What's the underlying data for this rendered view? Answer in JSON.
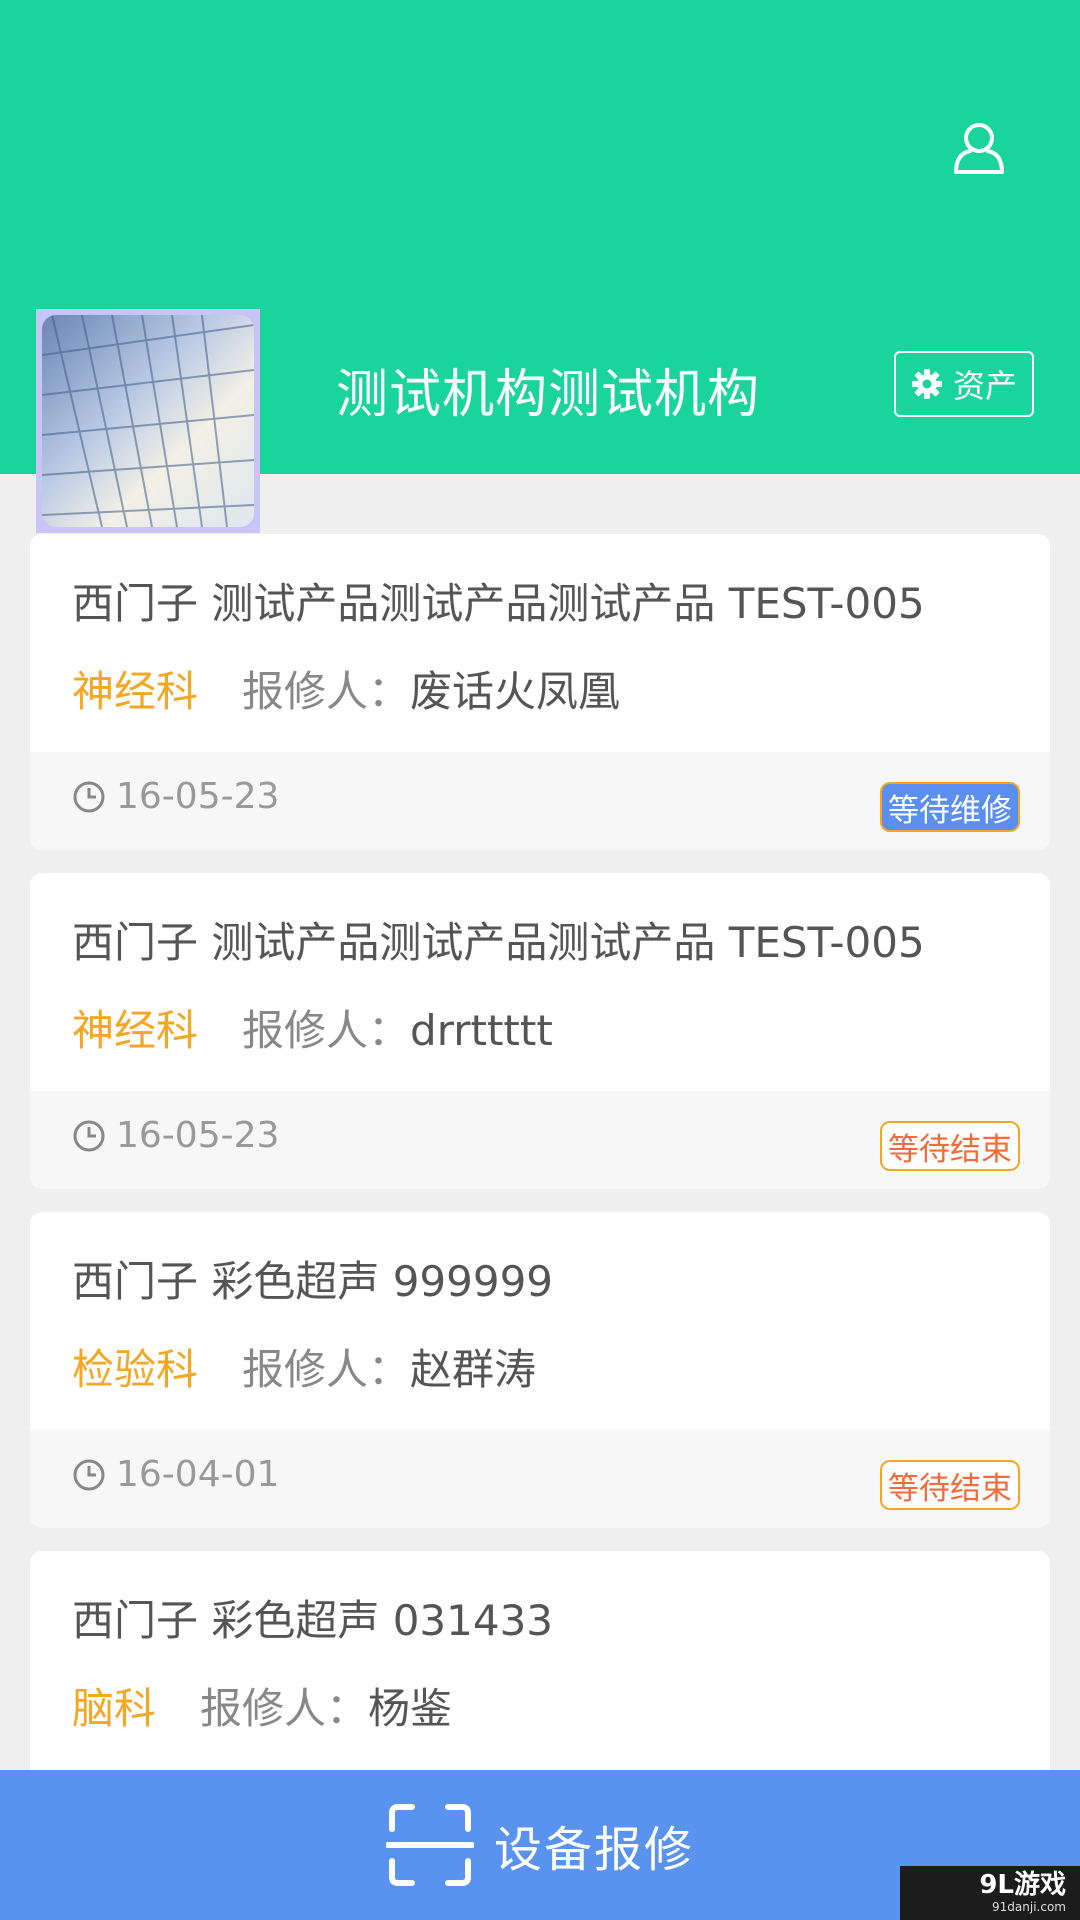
{
  "header": {
    "org_name": "测试机构测试机构",
    "assets_label": "资产",
    "profile_icon": "user-icon",
    "assets_icon": "gear-icon",
    "bg_color": "#19d59b"
  },
  "records": [
    {
      "title": "西门子 测试产品测试产品测试产品 TEST-005",
      "dept": "神经科",
      "reporter_label": "报修人：",
      "reporter": "废话火凤凰",
      "date": "16-05-23",
      "status": "等待维修"
    },
    {
      "title": "西门子 测试产品测试产品测试产品 TEST-005",
      "dept": "神经科",
      "reporter_label": "报修人：",
      "reporter": "drrttttt",
      "date": "16-05-23",
      "status": "等待结束"
    },
    {
      "title": "西门子 彩色超声 999999",
      "dept": "检验科",
      "reporter_label": "报修人：",
      "reporter": "赵群涛",
      "date": "16-04-01",
      "status": "等待结束"
    },
    {
      "title": "西门子 彩色超声 031433",
      "dept": "脑科",
      "reporter_label": "报修人：",
      "reporter": "杨鉴"
    }
  ],
  "bottom": {
    "label": "设备报修",
    "icon": "scan-icon",
    "bg_color": "#5a93ef"
  },
  "watermark": {
    "main": "9L游戏",
    "sub": "91danji.com"
  }
}
